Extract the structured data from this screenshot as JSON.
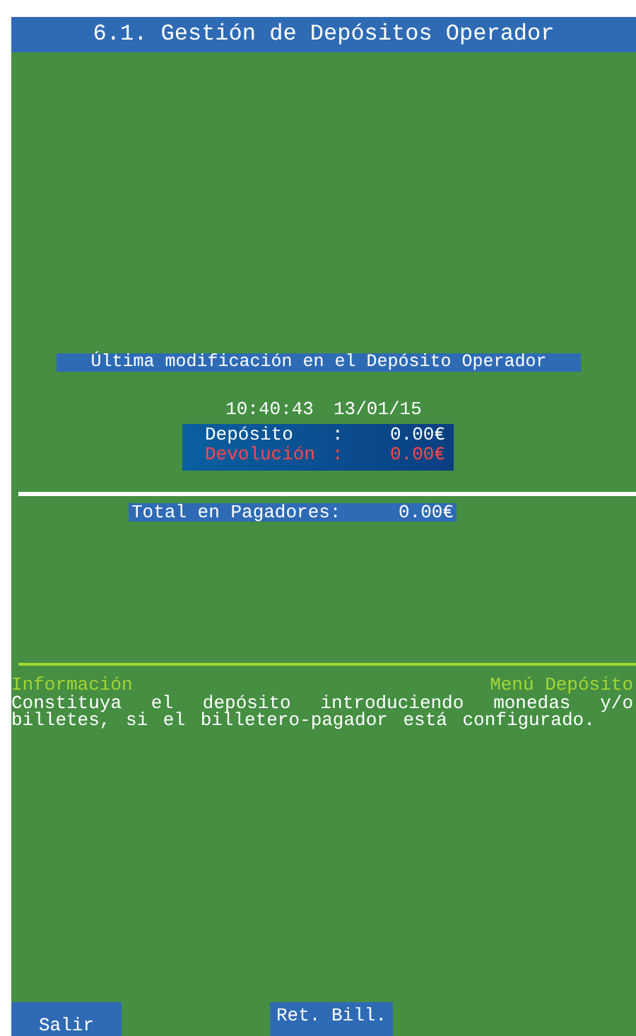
{
  "window": {
    "title": "6.1. Gestión de Depósitos Operador"
  },
  "last_modification": {
    "heading": "Última modificación en el Depósito Operador",
    "time": "10:40:43",
    "date": "13/01/15",
    "rows": [
      {
        "kind": "normal",
        "label": "Depósito",
        "separator": ":",
        "value": "0.00€"
      },
      {
        "kind": "alert",
        "label": "Devolución",
        "separator": ":",
        "value": "0.00€"
      }
    ]
  },
  "total": {
    "label": "Total en Pagadores:",
    "value": "0.00€"
  },
  "info": {
    "title": "Información",
    "menu": "Menú Depósito",
    "message": "Constituya el depósito introduciendo monedas y/o billetes, si el billetero-pagador está configurado."
  },
  "buttons": [
    {
      "label": "Salir"
    },
    {
      "label": "Ret. Bill."
    }
  ]
}
